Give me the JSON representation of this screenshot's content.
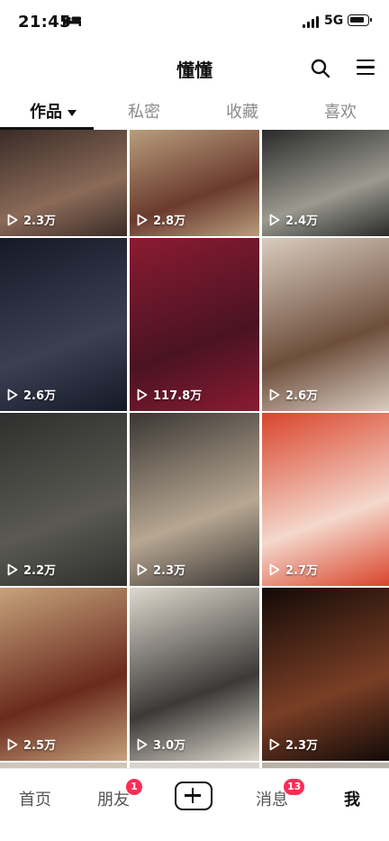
{
  "status_bar": {
    "time": "21:45",
    "network": "5G",
    "icons": [
      "bed-icon",
      "signal-icon",
      "battery-icon"
    ]
  },
  "header": {
    "title": "懂懂",
    "icons": [
      "search-icon",
      "menu-icon"
    ]
  },
  "tabs": [
    {
      "label": "作品",
      "active": true,
      "icon": "caret-down-icon"
    },
    {
      "label": "私密",
      "active": false
    },
    {
      "label": "收藏",
      "active": false
    },
    {
      "label": "喜欢",
      "active": false
    }
  ],
  "videos": [
    {
      "views": "2.3万",
      "subject": "woman portrait dark hair",
      "colors": [
        "#3a2c27",
        "#8b6a58"
      ]
    },
    {
      "views": "2.8万",
      "subject": "trench coat fur collar",
      "colors": [
        "#b89d7c",
        "#6b3b2e"
      ]
    },
    {
      "views": "2.4万",
      "subject": "old man grey beard",
      "colors": [
        "#2a2a2a",
        "#9a9a90"
      ]
    },
    {
      "views": "2.6万",
      "subject": "woman navy dress",
      "colors": [
        "#141a28",
        "#3c3f52"
      ]
    },
    {
      "views": "117.8万",
      "subject": "red knit sweater sequin skirt",
      "colors": [
        "#8b1b32",
        "#4a1322"
      ]
    },
    {
      "views": "2.6万",
      "subject": "desk with books and laptop",
      "colors": [
        "#d9ccbf",
        "#6e4e3c"
      ]
    },
    {
      "views": "2.2万",
      "subject": "two men at train",
      "colors": [
        "#2e2f2e",
        "#5a5a52"
      ]
    },
    {
      "views": "2.3万",
      "subject": "shop front with ladder",
      "colors": [
        "#3a3633",
        "#b7a792"
      ]
    },
    {
      "views": "2.7万",
      "subject": "red floral scarf",
      "colors": [
        "#d9442b",
        "#f4d8cc"
      ]
    },
    {
      "views": "2.5万",
      "subject": "woman reading braid",
      "colors": [
        "#c6a27c",
        "#6a2a1c"
      ]
    },
    {
      "views": "3.0万",
      "subject": "laptop desk with notebook",
      "colors": [
        "#ded7cc",
        "#3b3a38"
      ]
    },
    {
      "views": "2.3万",
      "subject": "dancers on stage",
      "colors": [
        "#130a07",
        "#7a3e25"
      ]
    }
  ],
  "bottom_nav": {
    "items": [
      {
        "label": "首页",
        "active": false
      },
      {
        "label": "朋友",
        "active": false,
        "badge": "1"
      },
      {
        "label": "",
        "icon": "add-icon"
      },
      {
        "label": "消息",
        "active": false,
        "badge": "13"
      },
      {
        "label": "我",
        "active": true
      }
    ]
  },
  "colors": {
    "accent_badge": "#fe2c55",
    "text_primary": "#111111",
    "text_muted": "#8a8a8a"
  }
}
